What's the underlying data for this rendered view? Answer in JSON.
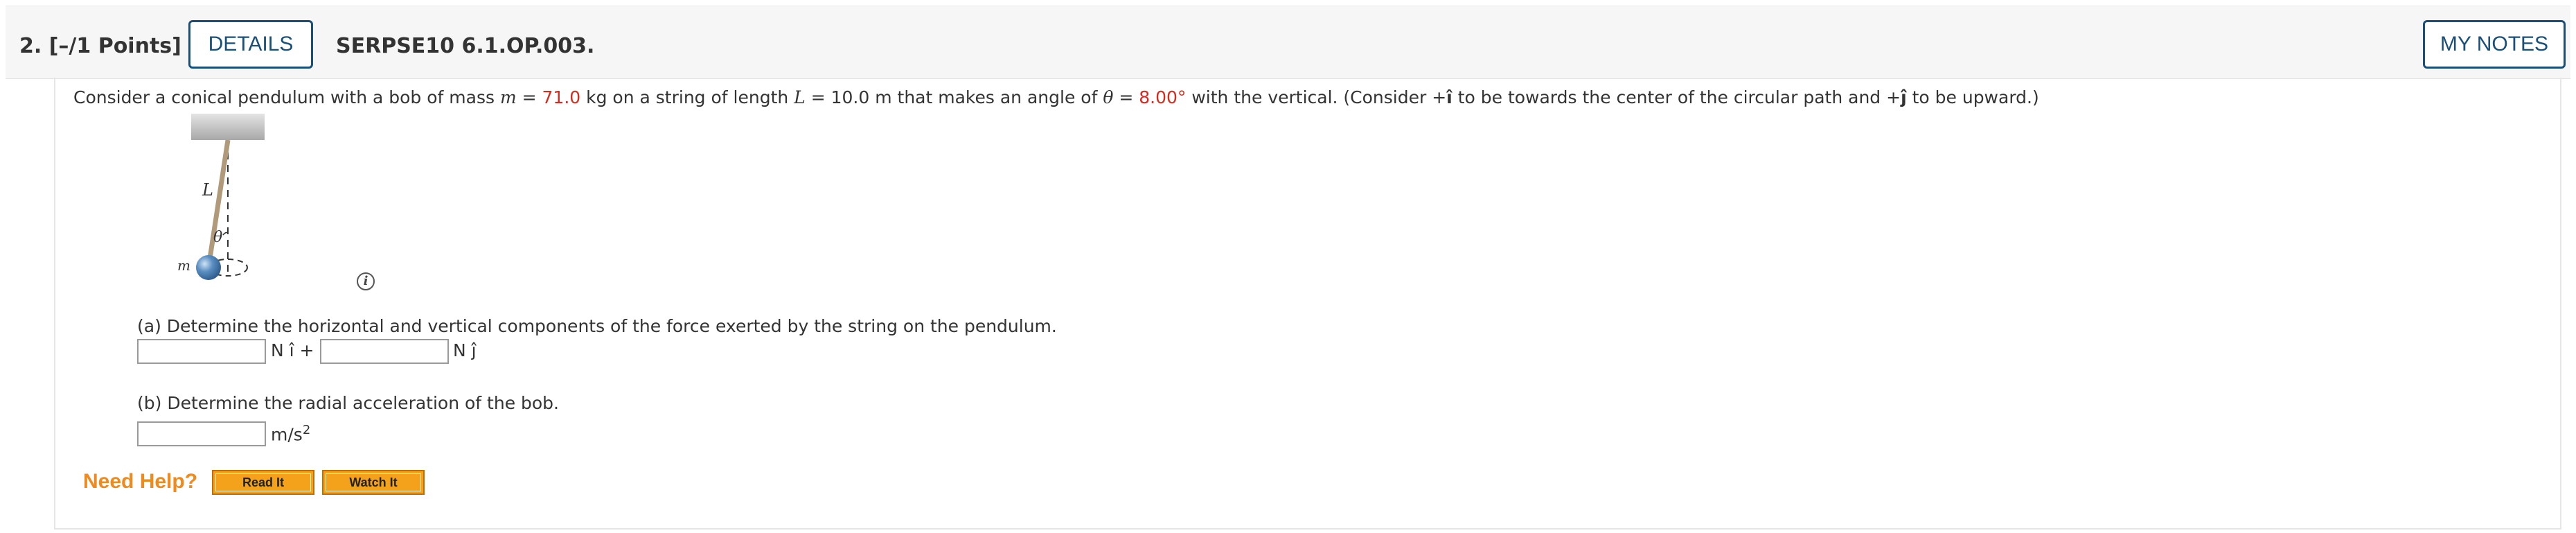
{
  "header": {
    "question_number": "2.  [–/1 Points]",
    "details_label": "DETAILS",
    "problem_code": "SERPSE10 6.1.OP.003.",
    "my_notes_label": "MY NOTES"
  },
  "question": {
    "t1": "Consider a conical pendulum with a bob of mass ",
    "m_var": "m",
    "t2": " = ",
    "mass_value": "71.0",
    "t3": " kg on a string of length ",
    "L_var": "L",
    "t4": " = 10.0 m that makes an angle of ",
    "theta_var": "θ",
    "t5": " = ",
    "angle_value": "8.00°",
    "t6": " with the vertical. (Consider +",
    "i_hat": "î",
    "t7": " to be towards the center of the circular path and +",
    "j_hat": "ĵ",
    "t8": " to be upward.)"
  },
  "figure": {
    "label_L": "L",
    "label_theta": "θ",
    "label_m": "m",
    "info_icon": "i"
  },
  "part_a": {
    "prompt": "(a) Determine the horizontal and vertical components of the force exerted by the string on the pendulum.",
    "input1_value": "",
    "unit1": "N î +",
    "input2_value": "",
    "unit2": "N ĵ"
  },
  "part_b": {
    "prompt": "(b) Determine the radial acceleration of the bob.",
    "input_value": "",
    "unit": "m/s",
    "unit_exp": "2"
  },
  "help": {
    "need_help_label": "Need Help?",
    "read_it_label": "Read It",
    "watch_it_label": "Watch It"
  },
  "colors": {
    "accent_blue": "#1a4f7a",
    "given_value_red": "#d32b1e",
    "help_orange": "#ef8a1e",
    "button_orange": "#f4a21b"
  }
}
